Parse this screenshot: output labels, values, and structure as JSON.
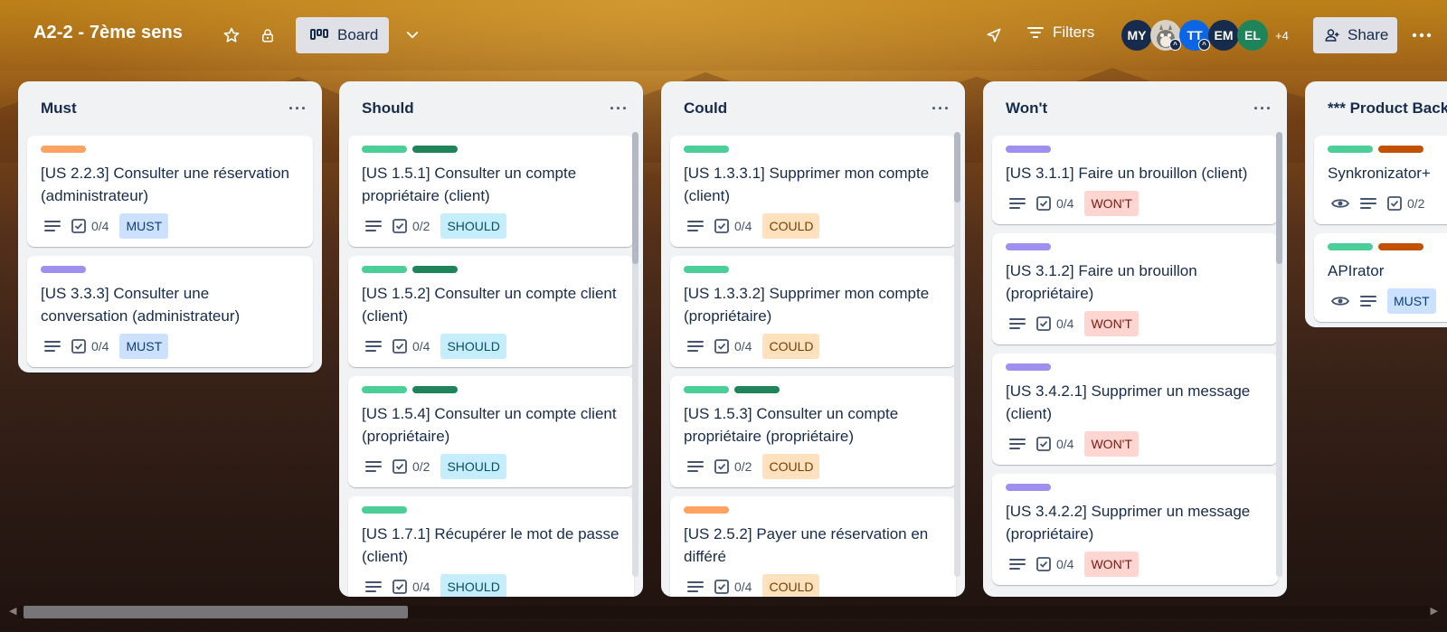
{
  "header": {
    "board_title": "A2-2 - 7ème sens",
    "view_label": "Board",
    "filters_label": "Filters",
    "share_label": "Share",
    "avatars": [
      {
        "initials": "MY",
        "color": "#172b4d"
      },
      {
        "initials": "",
        "color": "#c9c2b5"
      },
      {
        "initials": "TT",
        "color": "#0c66e4"
      },
      {
        "initials": "EM",
        "color": "#172b4d"
      },
      {
        "initials": "EL",
        "color": "#1f845a"
      }
    ],
    "more_members": "+4"
  },
  "colors": {
    "green": "#4bce97",
    "dark_green": "#1f845a",
    "orange": "#fea362",
    "purple": "#9f8fef",
    "dark_orange": "#c25100"
  },
  "lists": [
    {
      "title": "Must",
      "cards": [
        {
          "title": "[US 2.2.3] Consulter une réservation (administrateur)",
          "checklist": "0/4",
          "tag": "MUST"
        },
        {
          "title": "[US 3.3.3] Consulter une conversation (administrateur)",
          "checklist": "0/4",
          "tag": "MUST"
        }
      ]
    },
    {
      "title": "Should",
      "cards": [
        {
          "title": "[US 1.5.1] Consulter un compte propriétaire (client)",
          "checklist": "0/2",
          "tag": "SHOULD"
        },
        {
          "title": "[US 1.5.2] Consulter un compte client (client)",
          "checklist": "0/4",
          "tag": "SHOULD"
        },
        {
          "title": "[US 1.5.4] Consulter un compte client (propriétaire)",
          "checklist": "0/2",
          "tag": "SHOULD"
        },
        {
          "title": "[US 1.7.1] Récupérer le mot de passe (client)",
          "checklist": "0/4",
          "tag": "SHOULD"
        }
      ]
    },
    {
      "title": "Could",
      "cards": [
        {
          "title": "[US 1.3.3.1] Supprimer mon compte (client)",
          "checklist": "0/4",
          "tag": "COULD"
        },
        {
          "title": "[US 1.3.3.2] Supprimer mon compte (propriétaire)",
          "checklist": "0/4",
          "tag": "COULD"
        },
        {
          "title": "[US 1.5.3] Consulter un compte propriétaire (propriétaire)",
          "checklist": "0/2",
          "tag": "COULD"
        },
        {
          "title": "[US 2.5.2] Payer une réservation en différé",
          "checklist": "0/4",
          "tag": "COULD"
        }
      ]
    },
    {
      "title": "Won't",
      "cards": [
        {
          "title": "[US 3.1.1] Faire un brouillon (client)",
          "checklist": "0/4",
          "tag": "WON'T"
        },
        {
          "title": "[US 3.1.2] Faire un brouillon (propriétaire)",
          "checklist": "0/4",
          "tag": "WON'T"
        },
        {
          "title": "[US 3.4.2.1] Supprimer un message (client)",
          "checklist": "0/4",
          "tag": "WON'T"
        },
        {
          "title": "[US 3.4.2.2] Supprimer un message (propriétaire)",
          "checklist": "0/4",
          "tag": "WON'T"
        }
      ]
    },
    {
      "title": "*** Product Backl",
      "cards": [
        {
          "title": "Synkronizator+",
          "checklist": "0/2",
          "tag": ""
        },
        {
          "title": "APIrator",
          "checklist": "",
          "tag": "MUST"
        }
      ]
    }
  ]
}
